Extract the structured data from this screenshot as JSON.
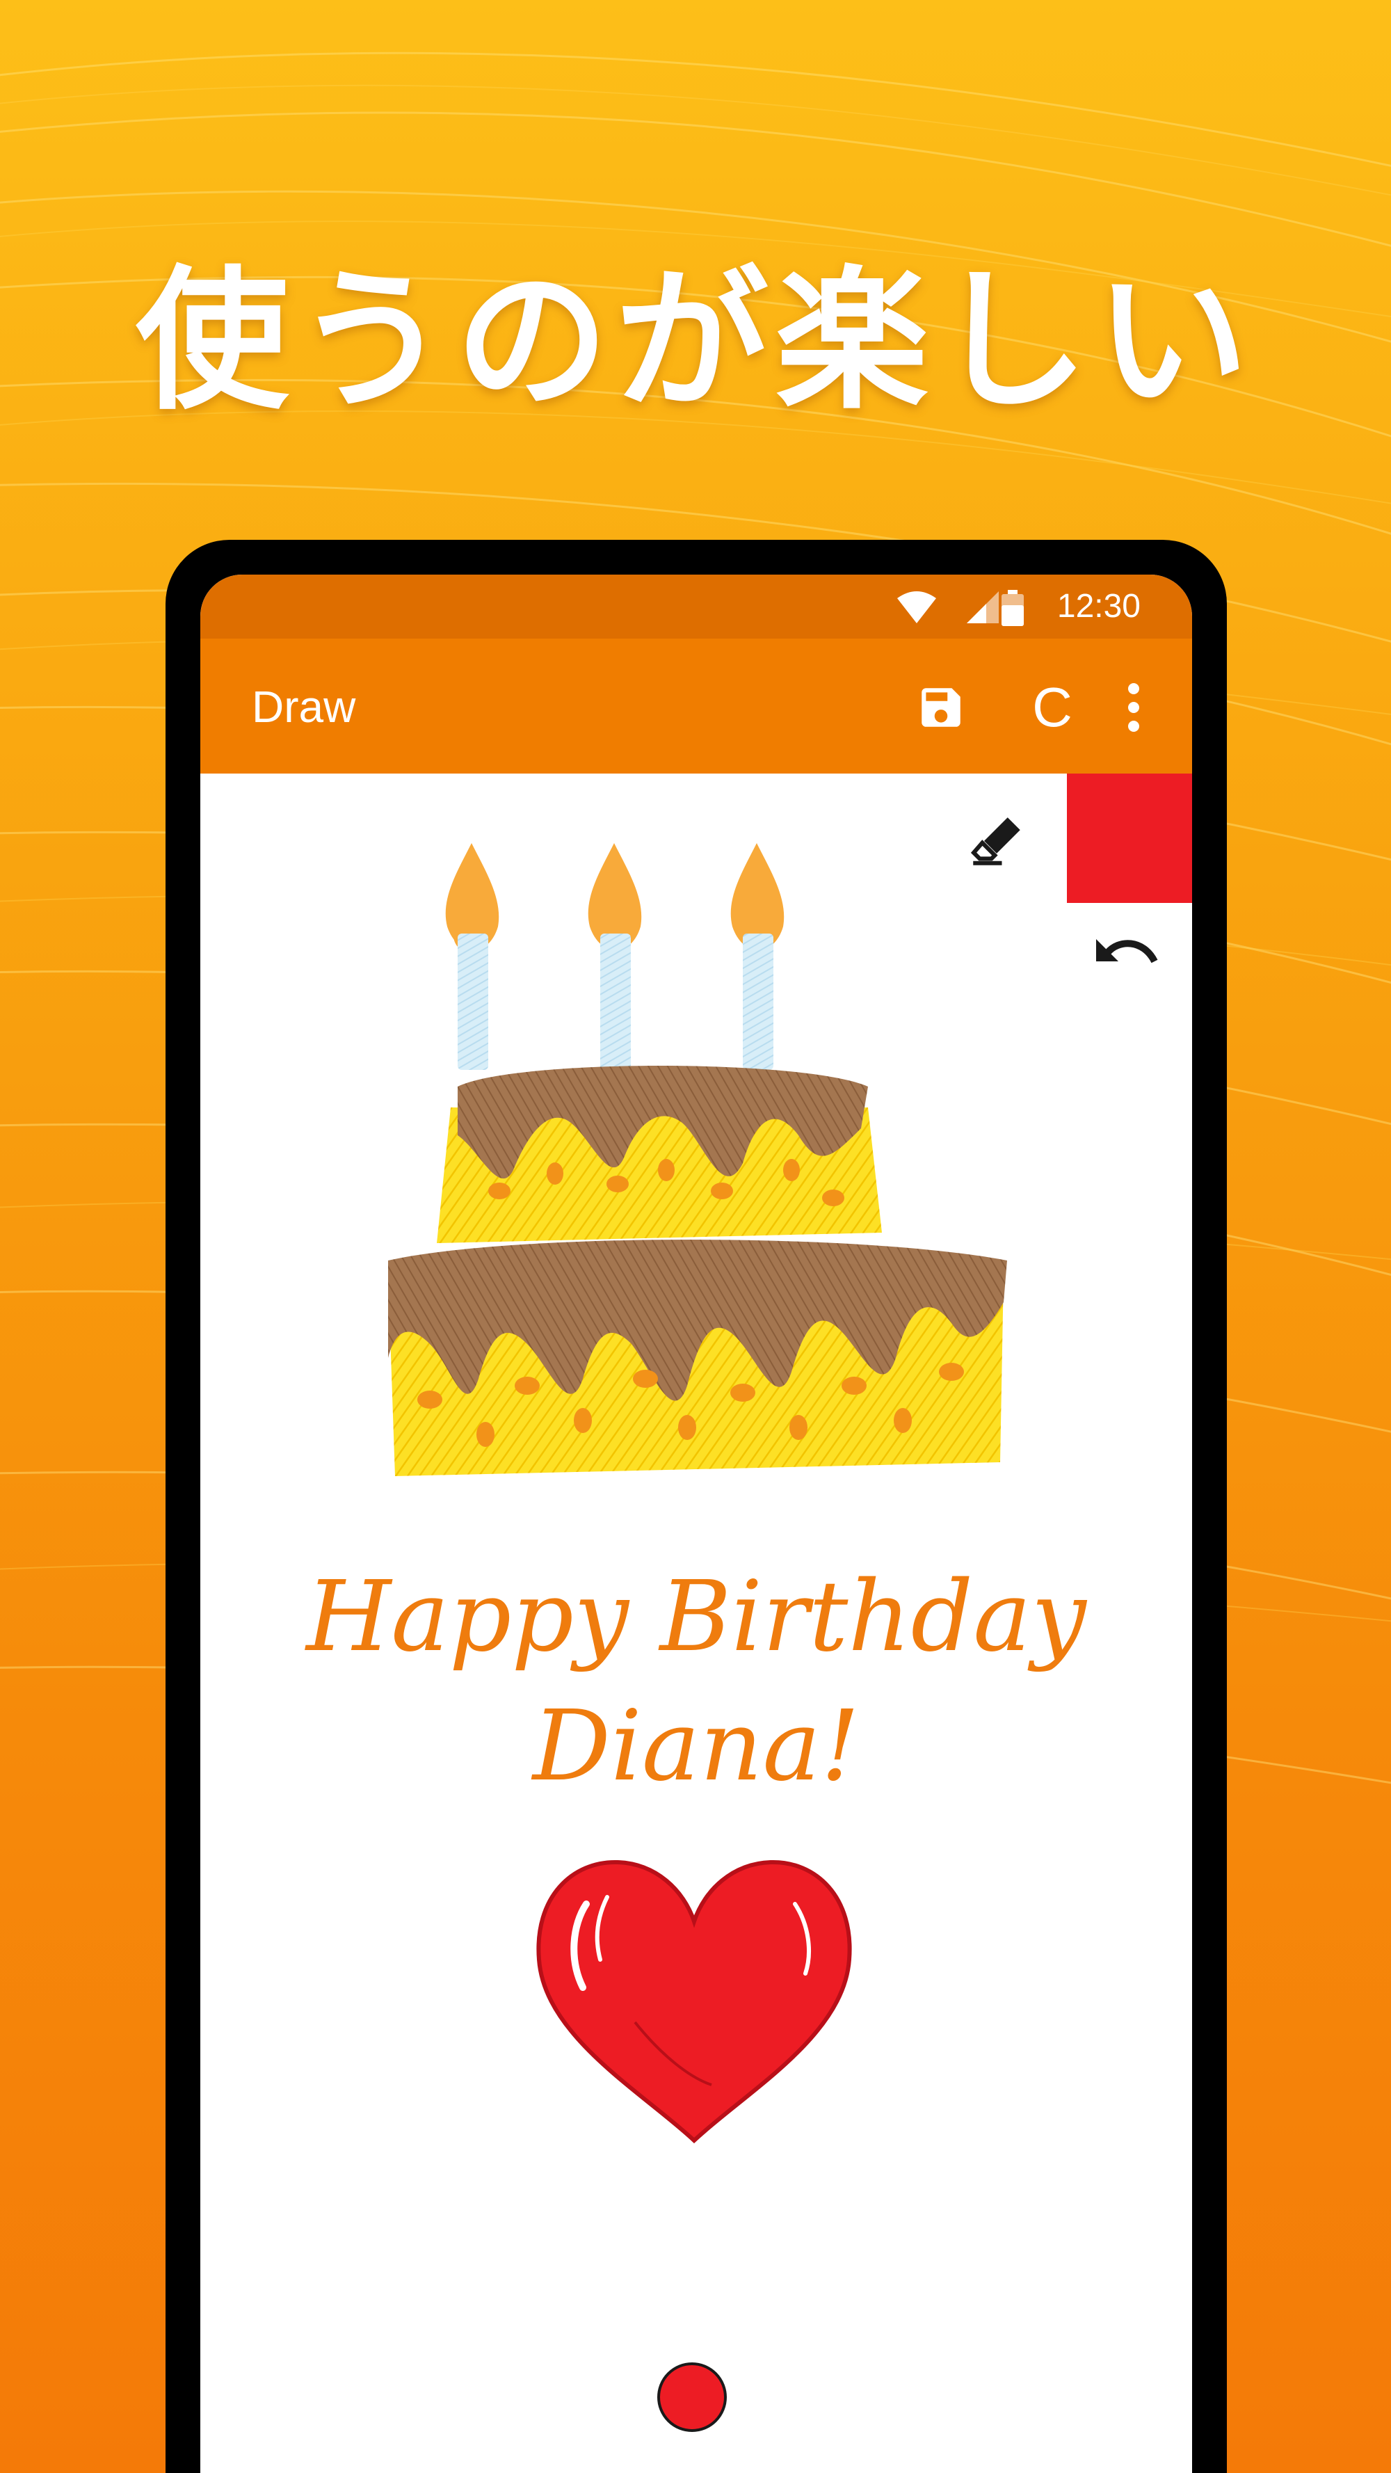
{
  "headline": "使うのが楽しい",
  "status_bar": {
    "time": "12:30"
  },
  "toolbar": {
    "title": "Draw",
    "clear_label": "C"
  },
  "icons": {
    "wifi": "wifi-icon",
    "signal": "signal-icon",
    "battery": "battery-icon",
    "save": "save-icon",
    "more": "more-vert-icon",
    "eraser": "eraser-icon",
    "undo": "undo-icon"
  },
  "canvas": {
    "greeting_line1": "Happy Birthday",
    "greeting_line2": "Diana!"
  },
  "colors": {
    "background_top": "#fdbf18",
    "background_bottom": "#f47a08",
    "status_bar": "#de6e00",
    "toolbar": "#f07d00",
    "selected_color": "#ed1c24",
    "greeting_text": "#ef7c0e"
  }
}
